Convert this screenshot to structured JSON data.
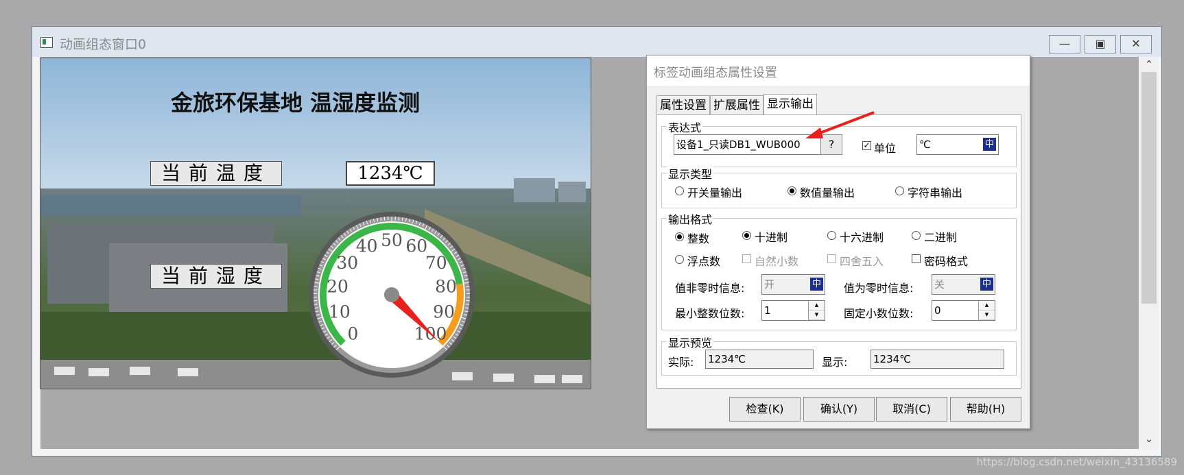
{
  "window": {
    "title": "动画组态窗口0"
  },
  "scene": {
    "heading": "金旅环保基地 温湿度监测",
    "temp_label": "当前温度",
    "temp_value": "1234℃",
    "humidity_label": "当前湿度",
    "gauge": {
      "ticks": [
        "0",
        "10",
        "20",
        "30",
        "40",
        "50",
        "60",
        "70",
        "80",
        "90",
        "100"
      ],
      "min": 0,
      "max": 100,
      "needle_value": 100,
      "colors": {
        "normal": "#3cb648",
        "warning": "#f39c1e",
        "needle": "#e8211c"
      }
    }
  },
  "dialog": {
    "title": "标签动画组态属性设置",
    "tabs": [
      {
        "label": "属性设置"
      },
      {
        "label": "扩展属性"
      },
      {
        "label": "显示输出"
      }
    ],
    "expression": {
      "group_label": "表达式",
      "value": "设备1_只读DB1_WUB000",
      "help_button": "?",
      "unit_label": "单位",
      "unit_checked": true,
      "unit_value": "℃",
      "cn_icon": "中"
    },
    "display_type": {
      "group_label": "显示类型",
      "options": [
        "开关量输出",
        "数值量输出",
        "字符串输出"
      ],
      "selected": "数值量输出"
    },
    "output_format": {
      "group_label": "输出格式",
      "type_options": [
        "整数",
        "浮点数"
      ],
      "type_selected": "整数",
      "base_options": [
        "十进制",
        "十六进制",
        "二进制"
      ],
      "base_selected": "十进制",
      "natural_decimal": "自然小数",
      "round": "四舍五入",
      "password": "密码格式",
      "nonzero_label": "值非零时信息:",
      "nonzero_value": "开",
      "zero_label": "值为零时信息:",
      "zero_value": "关",
      "min_int_label": "最小整数位数:",
      "min_int_value": "1",
      "fixed_dec_label": "固定小数位数:",
      "fixed_dec_value": "0"
    },
    "preview": {
      "group_label": "显示预览",
      "actual_label": "实际:",
      "actual_value": "1234℃",
      "display_label": "显示:",
      "display_value": "1234℃"
    },
    "buttons": {
      "check": "检查(K)",
      "ok": "确认(Y)",
      "cancel": "取消(C)",
      "help": "帮助(H)"
    }
  },
  "watermark": "https://blog.csdn.net/weixin_43136589"
}
